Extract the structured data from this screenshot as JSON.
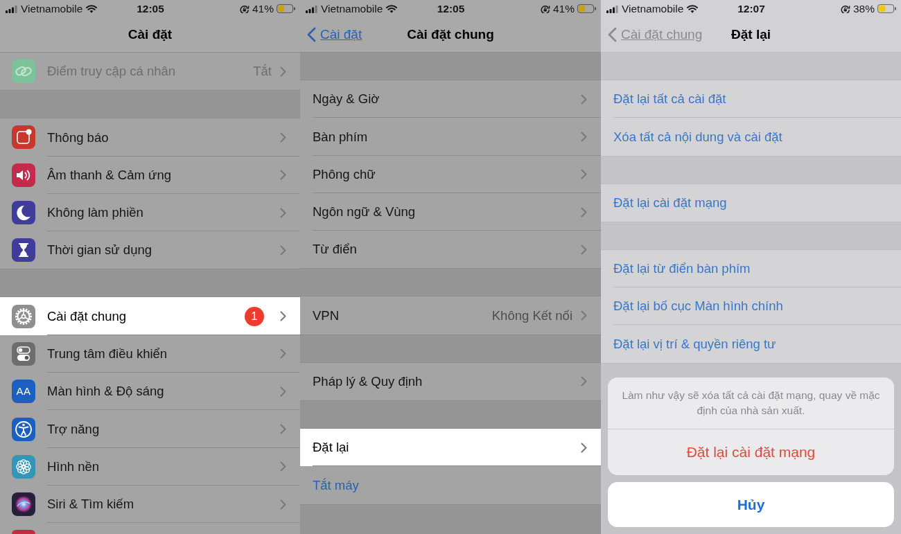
{
  "screens": [
    {
      "dimmed": true,
      "status_bar": {
        "carrier": "Vietnamobile",
        "time": "12:05",
        "battery": "41%"
      },
      "nav": {
        "title": "Cài đặt"
      },
      "groups": [
        {
          "items": [
            {
              "kind": "link",
              "label": "Điểm truy cập cá nhân",
              "value": "Tắt",
              "color": "#7cc39a",
              "selected": false,
              "disabled": true
            }
          ]
        },
        {
          "items": [
            {
              "kind": "link",
              "label": "Thông báo",
              "color": "#c8372d",
              "selected": false,
              "disabled": false
            },
            {
              "kind": "link",
              "label": "Âm thanh & Cảm ứng",
              "color": "#c42a4c",
              "selected": false,
              "disabled": false
            },
            {
              "kind": "link",
              "label": "Không làm phiền",
              "color": "#3f3c9a",
              "selected": false,
              "disabled": false
            },
            {
              "kind": "link",
              "label": "Thời gian sử dụng",
              "color": "#3f3c9a",
              "selected": false,
              "disabled": false
            }
          ]
        },
        {
          "items": [
            {
              "kind": "link",
              "label": "Cài đặt chung",
              "badge": "1",
              "color": "#8e8e93",
              "selected": true,
              "disabled": false
            },
            {
              "kind": "link",
              "label": "Trung tâm điều khiển",
              "color": "#6d6d70",
              "selected": false,
              "disabled": false
            },
            {
              "kind": "link",
              "label": "Màn hình & Độ sáng",
              "icon_text": "AA",
              "color": "#1d5fc0",
              "selected": false,
              "disabled": false
            },
            {
              "kind": "link",
              "label": "Trợ năng",
              "color": "#1d5fc0",
              "selected": false,
              "disabled": false
            },
            {
              "kind": "link",
              "label": "Hình nền",
              "color": "#3496b5",
              "selected": false,
              "disabled": false
            },
            {
              "kind": "link",
              "label": "Siri & Tìm kiếm",
              "color": "#27203c",
              "selected": false,
              "disabled": false
            },
            {
              "kind": "clipped",
              "color": "#c12a3f"
            }
          ]
        }
      ]
    },
    {
      "dimmed": true,
      "status_bar": {
        "carrier": "Vietnamobile",
        "time": "12:05",
        "battery": "41%"
      },
      "nav": {
        "back": "Cài đặt",
        "title": "Cài đặt chung"
      },
      "groups": [
        {
          "items": [
            {
              "kind": "link",
              "label": "Ngày & Giờ",
              "selected": false
            },
            {
              "kind": "link",
              "label": "Bàn phím",
              "selected": false
            },
            {
              "kind": "link",
              "label": "Phông chữ",
              "selected": false
            },
            {
              "kind": "link",
              "label": "Ngôn ngữ & Vùng",
              "selected": false
            },
            {
              "kind": "link",
              "label": "Từ điển",
              "selected": false
            }
          ]
        },
        {
          "items": [
            {
              "kind": "link",
              "label": "VPN",
              "value": "Không Kết nối",
              "selected": false
            }
          ]
        },
        {
          "items": [
            {
              "kind": "link",
              "label": "Pháp lý & Quy định",
              "selected": false
            }
          ]
        },
        {
          "items": [
            {
              "kind": "link",
              "label": "Đặt lại",
              "selected": true
            },
            {
              "kind": "action",
              "label": "Tắt máy",
              "selected": false
            }
          ]
        }
      ]
    },
    {
      "dimmed": false,
      "status_bar": {
        "carrier": "Vietnamobile",
        "time": "12:07",
        "battery": "38%"
      },
      "nav": {
        "back": "Cài đặt chung",
        "title": "Đặt lại"
      },
      "groups": [
        {
          "items": [
            {
              "kind": "action",
              "label": "Đặt lại tất cả cài đặt",
              "selected": false
            },
            {
              "kind": "action",
              "label": "Xóa tất cả nội dung và cài đặt",
              "selected": false
            }
          ]
        },
        {
          "items": [
            {
              "kind": "action",
              "label": "Đặt lại cài đặt mạng",
              "selected": false
            }
          ]
        },
        {
          "items": [
            {
              "kind": "action",
              "label": "Đặt lại từ điển bàn phím",
              "selected": false
            },
            {
              "kind": "action",
              "label": "Đặt lại bố cục Màn hình chính",
              "selected": false
            },
            {
              "kind": "action",
              "label": "Đặt lại vị trí & quyền riêng tư",
              "selected": false
            }
          ]
        }
      ],
      "action_sheet": {
        "message": "Làm như vậy sẽ xóa tất cả cài đặt mạng, quay về mặc định của nhà sản xuất.",
        "actions": [
          {
            "kind": "destructive",
            "label": "Đặt lại cài đặt mạng"
          }
        ],
        "cancel": "Hủy"
      }
    }
  ]
}
